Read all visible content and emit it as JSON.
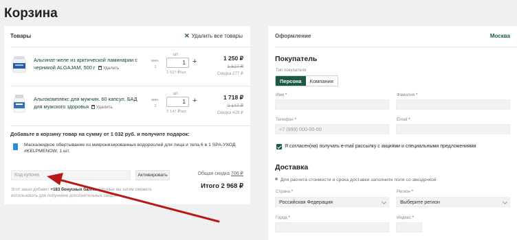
{
  "page": {
    "title": "Корзина"
  },
  "cart": {
    "header": "Товары",
    "remove_all": "Удалить все товары",
    "items": [
      {
        "name": "Альгинат-желе из арктической ламинарии с черникой ALGAJAM, 500 г",
        "delete": "Удалить",
        "qty_label": "шт.",
        "min_label": "мин.",
        "min_value": "1",
        "qty": "1",
        "unit_price": "1 527 ₽/шт.",
        "price": "1 250 ₽",
        "old_price": "1 527 ₽",
        "discount": "Скидка 277 ₽"
      },
      {
        "name": "Альгокомплекс для мужчин. 60 капсул. БАД для мужского здоровья",
        "delete": "Удалить",
        "qty_label": "шт.",
        "min_label": "мин.",
        "min_value": "1",
        "qty": "1",
        "unit_price": "2 147 ₽/шт.",
        "price": "1 718 ₽",
        "old_price": "2 147 ₽",
        "discount": "Скидка 429 ₽"
      }
    ],
    "gift": {
      "title": "Добавьте в корзину товар на сумму от 1 032 руб. и получите подарок:",
      "text": "Маска/жидкое обертывание из микронизированных водорослей для лица и тела 6 в 1 SPA-УХОД #KELPMENOW, 1 шт."
    },
    "coupon": {
      "placeholder": "Код купона",
      "button": "Активировать"
    },
    "total_discount_label": "Общая скидка",
    "total_discount_value": "706 ₽",
    "bonus_prefix": "Этот заказ добавит",
    "bonus_value": "+183 бонусных балла",
    "bonus_suffix": ", которые вы затем сможете использовать для получения дополнительных скидок.",
    "total": "Итого 2 968 ₽"
  },
  "checkout": {
    "header": "Оформление",
    "city": "Москва",
    "buyer_title": "Покупатель",
    "buyer_type_label": "Тип покупателя",
    "buyer_types": [
      "Персона",
      "Компания"
    ],
    "first_name_label": "Имя",
    "last_name_label": "Фамилия",
    "phone_label": "Телефон",
    "phone_placeholder": "+7 (999) 000-00-00",
    "email_label": "Email",
    "subscribe_label": "Я согласен(на) получать e-mail рассылку с акциями и специальными предложениями",
    "delivery_title": "Доставка",
    "delivery_hint": "Для расчета стоимости и срока доставки заполните поля со звездочкой",
    "country_label": "Страна",
    "country_value": "Российская Федерация",
    "region_label": "Регион",
    "region_value": "Выберите регион",
    "city_label": "Город",
    "zip_label": "Индекс"
  }
}
